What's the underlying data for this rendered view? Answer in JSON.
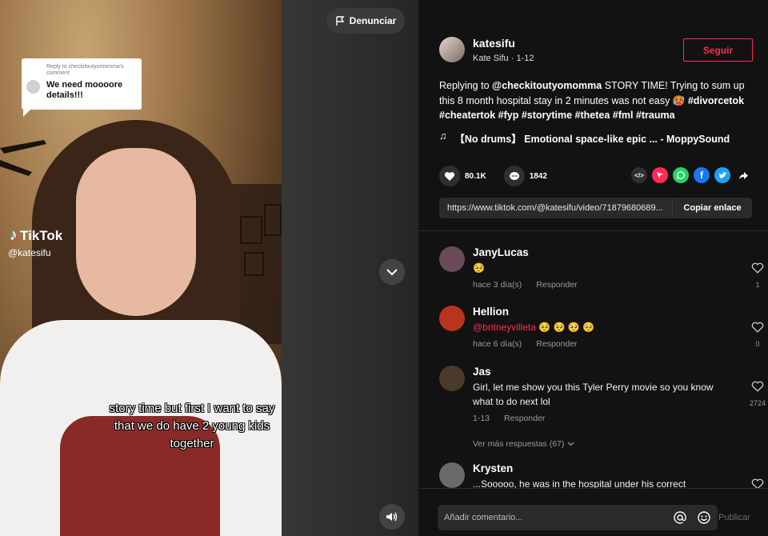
{
  "video": {
    "reply_card": {
      "small": "Reply to checkitoutyomomma's comment",
      "text": "We need moooore details!!!"
    },
    "logo_text": "TikTok",
    "watermark_user": "@katesifu",
    "caption": "story time but first I want to say that we do have 2 young kids together",
    "report_label": "Denunciar"
  },
  "author": {
    "username": "katesifu",
    "display_name": "Kate Sifu",
    "date": "1-12",
    "follow_label": "Seguir"
  },
  "description": {
    "prefix": "Replying to ",
    "mention": "@checkitoutyomomma",
    "text": " STORY TIME! Trying to sum up this 8 month hospital stay in 2 minutes was not easy 🥵 ",
    "tags": "#divorcetok #cheatertok #fyp #storytime #thetea #fml #trauma"
  },
  "music": "【No drums】 Emotional space-like epic ... - MoppySound",
  "stats": {
    "likes": "80.1K",
    "comments": "1842"
  },
  "share_link": {
    "url": "https://www.tiktok.com/@katesifu/video/71879680689...",
    "copy_label": "Copiar enlace"
  },
  "comments": [
    {
      "user": "JanyLucas",
      "text": "🥺",
      "mention": "",
      "date": "hace 3 día(s)",
      "reply": "Responder",
      "likes": "1",
      "avatar_color": "#6b4a5a"
    },
    {
      "user": "Hellion",
      "text": " 🥺 🥺 🥺 🥺",
      "mention": "@britneyvilleta",
      "date": "hace 6 día(s)",
      "reply": "Responder",
      "likes": "0",
      "avatar_color": "#b8341c"
    },
    {
      "user": "Jas",
      "text": "Girl, let me show you this Tyler Perry movie so you know what to do next lol",
      "mention": "",
      "date": "1-13",
      "reply": "Responder",
      "likes": "2724",
      "avatar_color": "#4a3a2a"
    },
    {
      "user": "Krysten",
      "text": "...Sooooo, he was in the hospital under his correct",
      "mention": "",
      "date": "",
      "reply": "",
      "likes": "",
      "avatar_color": "#6a6a6a"
    }
  ],
  "more_replies": "Ver más respuestas (67)",
  "comment_input": {
    "placeholder": "Añadir comentario...",
    "post_label": "Publicar"
  },
  "colors": {
    "accent": "#fe2c55",
    "panel_bg": "#121212",
    "muted": "#9a9a9a"
  },
  "icons": [
    "flag-icon",
    "chevron-down-icon",
    "volume-icon",
    "music-note-icon",
    "heart-icon",
    "comment-icon",
    "embed-icon",
    "send-icon",
    "whatsapp-icon",
    "facebook-icon",
    "twitter-icon",
    "share-arrow-icon",
    "at-icon",
    "emoji-icon"
  ]
}
